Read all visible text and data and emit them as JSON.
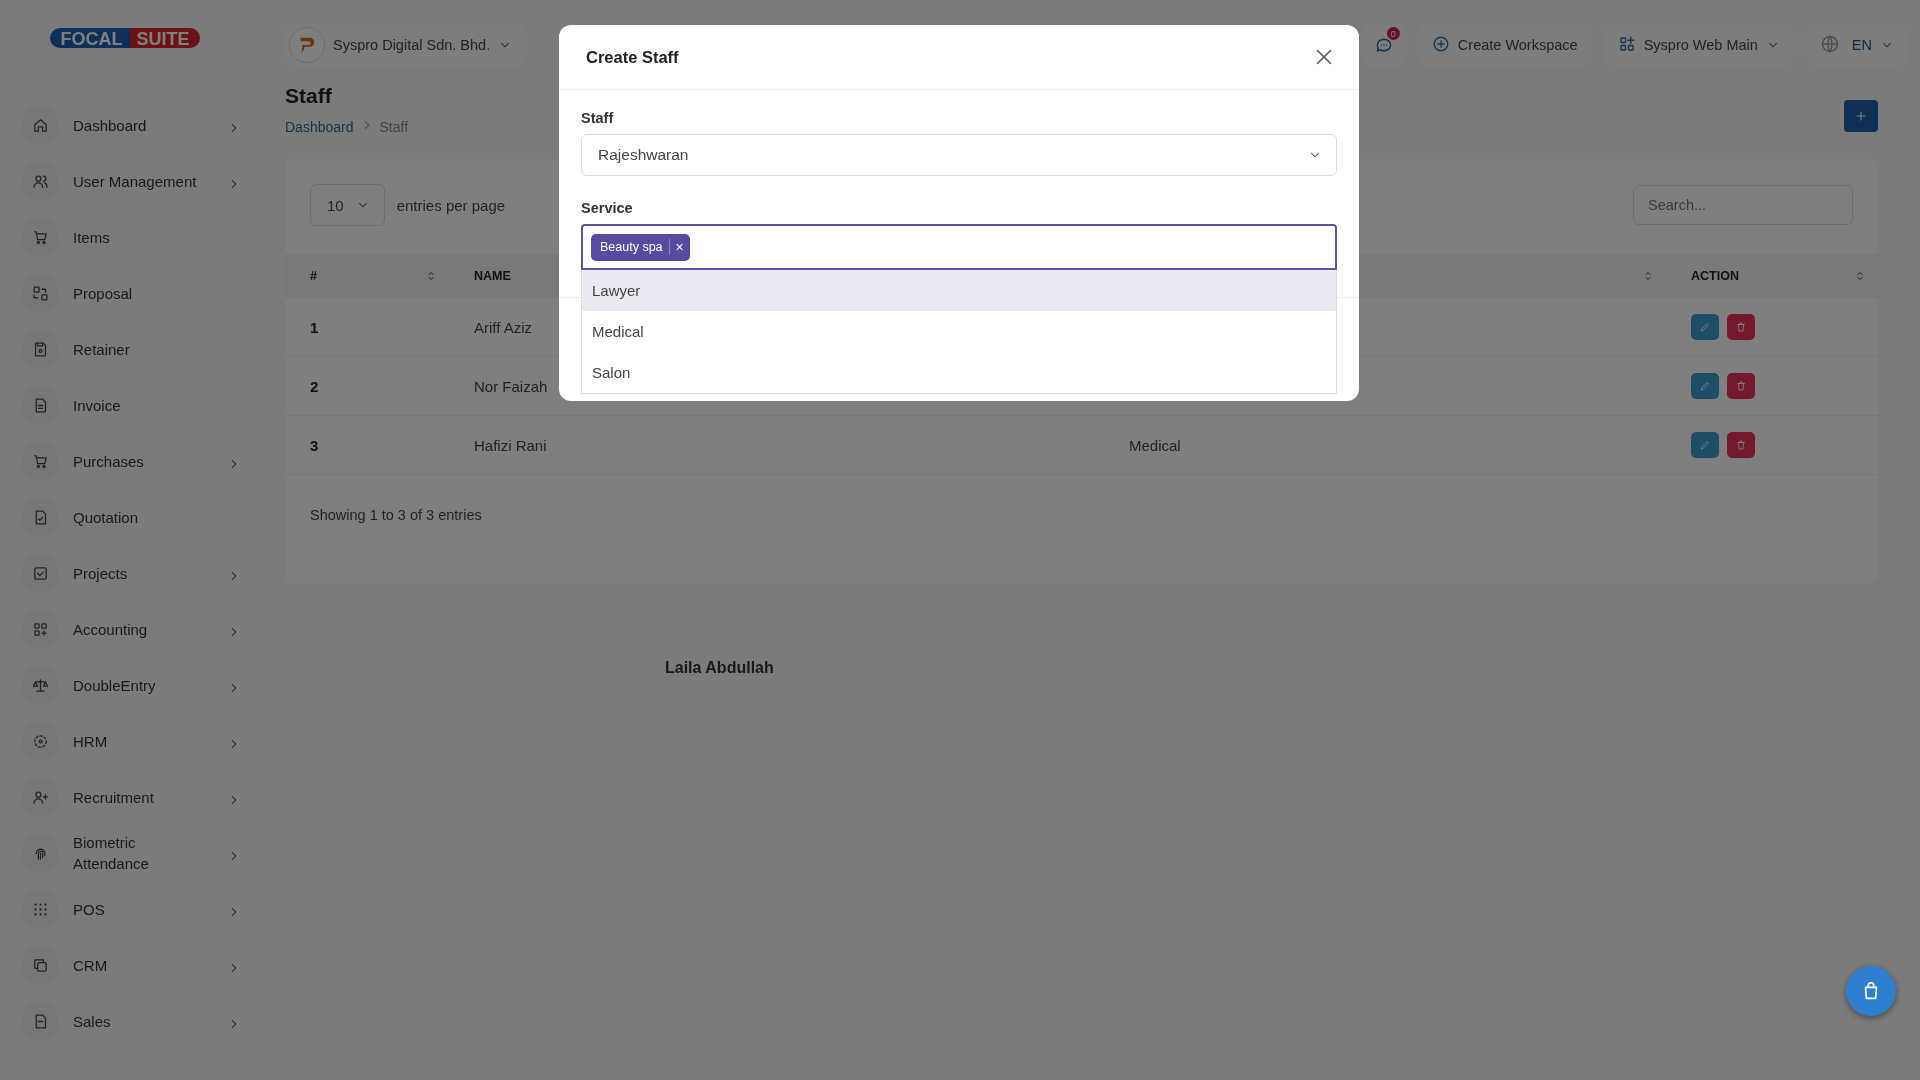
{
  "brand": {
    "logo_left": "FOCAL",
    "logo_right": "SUITE"
  },
  "sidebar": {
    "items": [
      {
        "label": "Dashboard",
        "has_submenu": true
      },
      {
        "label": "User Management",
        "has_submenu": true
      },
      {
        "label": "Items",
        "has_submenu": false
      },
      {
        "label": "Proposal",
        "has_submenu": false
      },
      {
        "label": "Retainer",
        "has_submenu": false
      },
      {
        "label": "Invoice",
        "has_submenu": false
      },
      {
        "label": "Purchases",
        "has_submenu": true
      },
      {
        "label": "Quotation",
        "has_submenu": false
      },
      {
        "label": "Projects",
        "has_submenu": true
      },
      {
        "label": "Accounting",
        "has_submenu": true
      },
      {
        "label": "DoubleEntry",
        "has_submenu": true
      },
      {
        "label": "HRM",
        "has_submenu": true
      },
      {
        "label": "Recruitment",
        "has_submenu": true
      },
      {
        "label": "Biometric Attendance",
        "has_submenu": true
      },
      {
        "label": "POS",
        "has_submenu": true
      },
      {
        "label": "CRM",
        "has_submenu": true
      },
      {
        "label": "Sales",
        "has_submenu": true
      }
    ]
  },
  "topbar": {
    "company": "Syspro Digital Sdn. Bhd.",
    "notifications": "0",
    "create_workspace": "Create Workspace",
    "workspace": "Syspro Web Main",
    "language": "EN"
  },
  "page": {
    "title": "Staff",
    "breadcrumb": [
      {
        "label": "Dashboard",
        "current": false
      },
      {
        "label": "Staff",
        "current": true
      }
    ]
  },
  "table": {
    "page_size": "10",
    "page_size_label": "entries per page",
    "search_placeholder": "Search...",
    "columns": {
      "index": "#",
      "name": "NAME",
      "action": "ACTION"
    },
    "rows": [
      {
        "index": "1",
        "name": "Ariff Aziz"
      },
      {
        "index": "2",
        "name": "Nor Faizah"
      },
      {
        "index": "3",
        "name": "Hafizi Rani",
        "column_3": "Medical"
      }
    ],
    "footer": "Showing 1 to 3 of 3 entries"
  },
  "floating_label": "Laila Abdullah",
  "modal": {
    "title": "Create Staff",
    "staff": {
      "label": "Staff",
      "value": "Rajeshwaran"
    },
    "service": {
      "label": "Service",
      "tags": [
        {
          "label": "Beauty spa",
          "remove": "×"
        }
      ],
      "options": [
        {
          "label": "Lawyer",
          "selected": true
        },
        {
          "label": "Medical",
          "selected": false
        },
        {
          "label": "Salon",
          "selected": false
        }
      ]
    }
  }
}
